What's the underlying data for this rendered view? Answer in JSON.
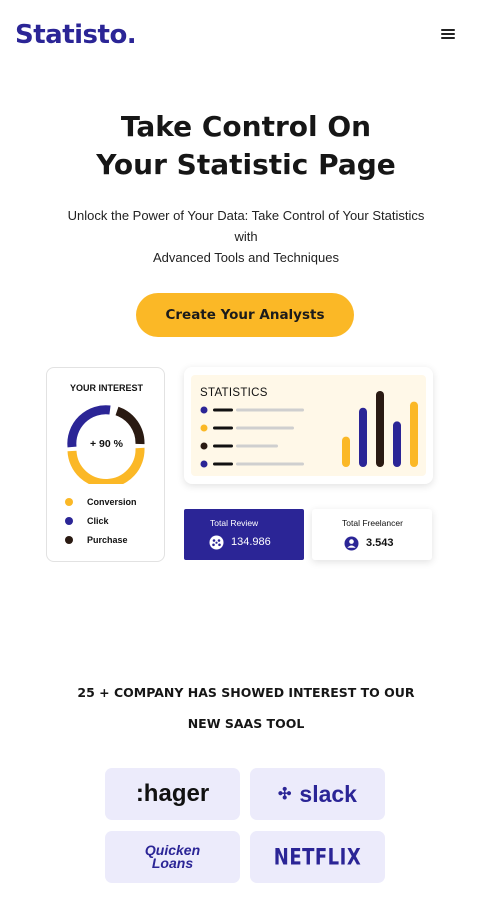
{
  "header": {
    "brand": "Statisto.",
    "menu_icon": "hamburger-menu-icon"
  },
  "hero": {
    "title_line1": "Take Control On",
    "title_line2": "Your Statistic Page",
    "subtitle_line1": "Unlock the Power of Your Data: Take Control of Your Statistics",
    "subtitle_line2": "with",
    "subtitle_line3": "Advanced Tools and Techniques",
    "cta_label": "Create Your Analysts"
  },
  "interest_card": {
    "title": "YOUR INTEREST",
    "donut_label": "+ 90 %",
    "legend": [
      {
        "label": "Conversion",
        "color": "#fbb826"
      },
      {
        "label": "Click",
        "color": "#2b2596"
      },
      {
        "label": "Purchase",
        "color": "#2a1a12"
      }
    ]
  },
  "stats_card": {
    "title": "STATISTICS",
    "bar_colors": [
      "#fbb826",
      "#2b2596",
      "#2a1a12",
      "#2b2596",
      "#fbb826"
    ],
    "bar_levels": [
      0.4,
      0.78,
      1.0,
      0.6,
      0.86
    ]
  },
  "review_card": {
    "label": "Total Review",
    "value": "134.986",
    "icon": "rating-icon"
  },
  "freelancer_card": {
    "label": "Total Freelancer",
    "value": "3.543",
    "icon": "user-icon"
  },
  "companies": {
    "heading_line1": "25 + COMPANY HAS SHOWED INTEREST TO OUR",
    "heading_line2": "NEW SAAS TOOL",
    "logos": [
      {
        "name": ":hager"
      },
      {
        "name": "slack"
      },
      {
        "name_line1": "Quicken",
        "name_line2": "Loans"
      },
      {
        "name": "NETFLIX"
      }
    ]
  },
  "colors": {
    "brand": "#2b2596",
    "accent": "#fbb826",
    "dark": "#2a1a12"
  }
}
